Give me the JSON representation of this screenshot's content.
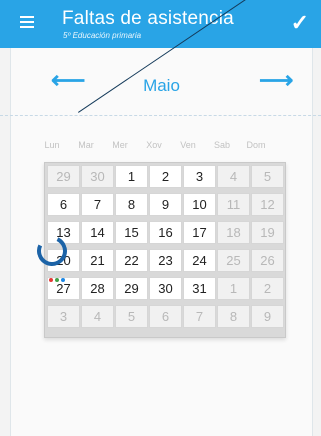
{
  "app": {
    "title": "Faltas de asistencia",
    "subtitle": "5º Educación primaria"
  },
  "calendar": {
    "month_label": "Maio",
    "weekdays": [
      "Lun",
      "Mar",
      "Mer",
      "Xov",
      "Ven",
      "Sab",
      "Dom"
    ],
    "weeks": [
      [
        29,
        30,
        1,
        2,
        3,
        4,
        5
      ],
      [
        6,
        7,
        8,
        9,
        10,
        11,
        12
      ],
      [
        13,
        14,
        15,
        16,
        17,
        18,
        19
      ],
      [
        20,
        21,
        22,
        23,
        24,
        25,
        26
      ],
      [
        27,
        28,
        29,
        30,
        31,
        1,
        2
      ],
      [
        3,
        4,
        5,
        6,
        7,
        8,
        9
      ]
    ]
  },
  "colors": {
    "accent": "#29a4e6",
    "spinner": "#1c63a7",
    "dot_red": "#e53935",
    "dot_green": "#43a047",
    "dot_blue": "#1e88e5"
  },
  "icons": {
    "menu": "hamburger-menu-icon",
    "confirm": "checkmark-icon",
    "prev": "arrow-left-icon",
    "next": "arrow-right-icon",
    "loading": "refresh-spinner-icon"
  }
}
